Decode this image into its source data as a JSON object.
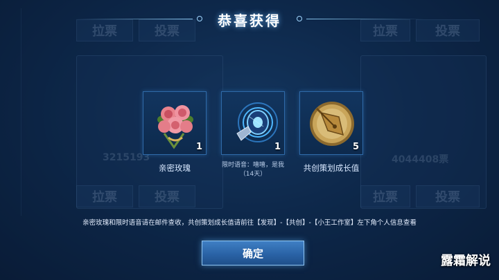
{
  "dialog": {
    "title": "恭喜获得",
    "items": [
      {
        "name": "亲密玫瑰",
        "count": "1",
        "icon": "rose-bouquet-icon"
      },
      {
        "name": "限时语音：嘻嘻，是我",
        "duration": "（14天）",
        "count": "1",
        "icon": "speaker-voice-icon"
      },
      {
        "name": "共创策划成长值",
        "count": "5",
        "icon": "pen-nib-badge-icon"
      }
    ],
    "notice": "亲密玫瑰和限时语音请在邮件查收，共创策划成长值请前往【发现】-【共创】-【小王工作室】左下角个人信息查看",
    "confirm_label": "确定"
  },
  "background": {
    "vote_label": "拉票",
    "vote2_label": "投票",
    "votes_left": "3215193",
    "votes_right": "4044408票"
  },
  "watermark": "露霜解说",
  "colors": {
    "accent": "#2f6aa8",
    "button": "#2a63a6",
    "title_glow": "#6ebeff"
  }
}
